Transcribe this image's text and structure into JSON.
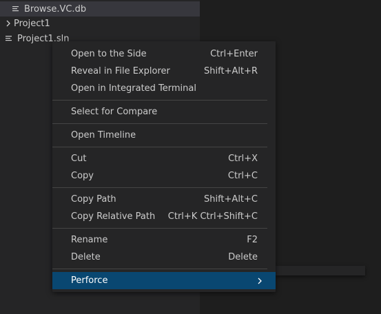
{
  "explorer": {
    "items": [
      {
        "label": "Browse.VC.db",
        "icon": "file-lines-icon",
        "selected": true
      },
      {
        "label": "Project1",
        "icon": "chevron-right-icon",
        "selected": false
      },
      {
        "label": "Project1.sln",
        "icon": "file-lines-icon",
        "selected": false
      }
    ]
  },
  "context_menu": {
    "groups": [
      [
        {
          "label": "Open to the Side",
          "shortcut": "Ctrl+Enter"
        },
        {
          "label": "Reveal in File Explorer",
          "shortcut": "Shift+Alt+R"
        },
        {
          "label": "Open in Integrated Terminal",
          "shortcut": ""
        }
      ],
      [
        {
          "label": "Select for Compare",
          "shortcut": ""
        }
      ],
      [
        {
          "label": "Open Timeline",
          "shortcut": ""
        }
      ],
      [
        {
          "label": "Cut",
          "shortcut": "Ctrl+X"
        },
        {
          "label": "Copy",
          "shortcut": "Ctrl+C"
        }
      ],
      [
        {
          "label": "Copy Path",
          "shortcut": "Shift+Alt+C"
        },
        {
          "label": "Copy Relative Path",
          "shortcut": "Ctrl+K Ctrl+Shift+C"
        }
      ],
      [
        {
          "label": "Rename",
          "shortcut": "F2"
        },
        {
          "label": "Delete",
          "shortcut": "Delete"
        }
      ],
      [
        {
          "label": "Perforce",
          "shortcut": "",
          "submenu": true,
          "active": true
        }
      ]
    ]
  },
  "colors": {
    "sidebar_bg": "#252526",
    "editor_bg": "#1e1e1e",
    "menu_bg": "#252526",
    "active_item_bg": "#094771",
    "separator": "#454545",
    "text": "#cccccc"
  }
}
